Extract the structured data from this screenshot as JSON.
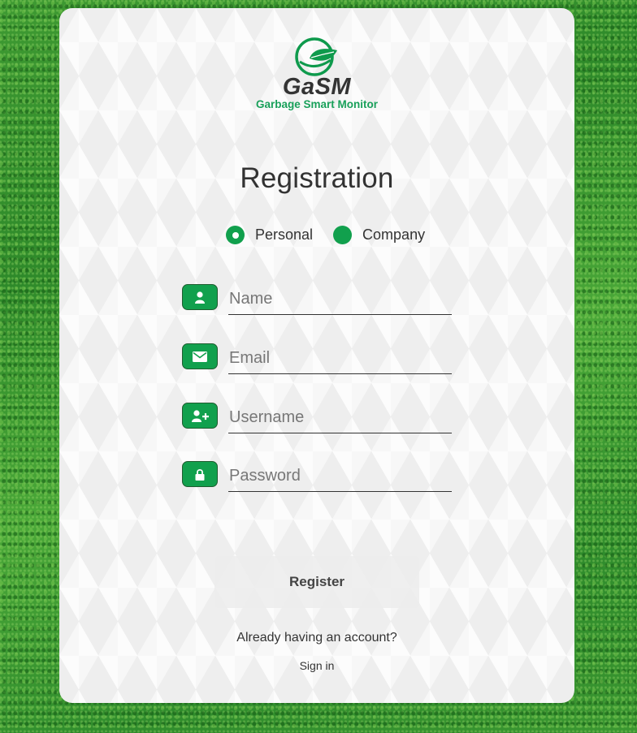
{
  "logo": {
    "name": "GaSM",
    "tagline": "Garbage Smart Monitor",
    "icon": "leaf-globe-icon"
  },
  "title": "Registration",
  "account_type": {
    "options": [
      {
        "label": "Personal",
        "selected": true
      },
      {
        "label": "Company",
        "selected": false
      }
    ]
  },
  "fields": {
    "name": {
      "placeholder": "Name",
      "value": "",
      "icon": "user-icon"
    },
    "email": {
      "placeholder": "Email",
      "value": "",
      "icon": "envelope-icon"
    },
    "username": {
      "placeholder": "Username",
      "value": "",
      "icon": "user-plus-icon"
    },
    "password": {
      "placeholder": "Password",
      "value": "",
      "icon": "lock-icon"
    }
  },
  "register_label": "Register",
  "account_prompt": "Already having an account?",
  "signin_label": "Sign in",
  "colors": {
    "accent": "#11a04d",
    "background": "#2f8c2c",
    "card": "#f7f7f7"
  }
}
